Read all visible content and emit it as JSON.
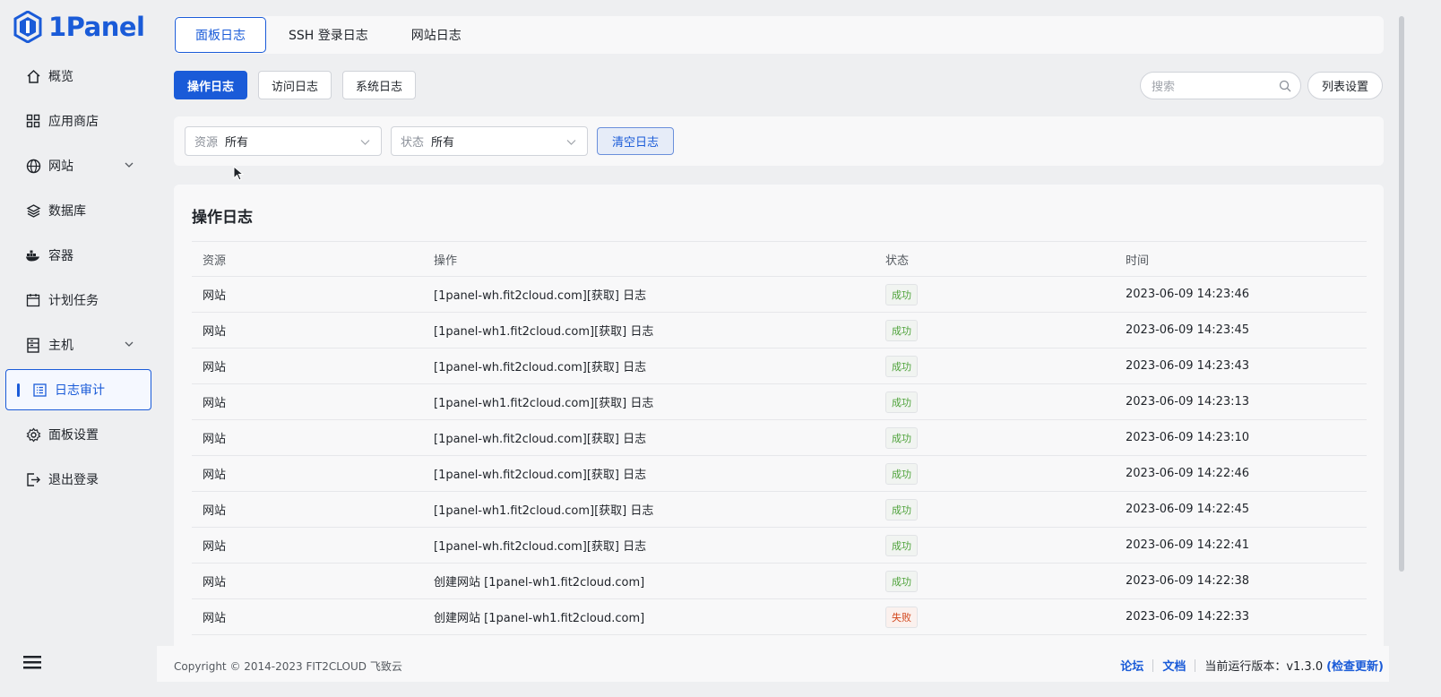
{
  "app": {
    "logo_text": "1Panel"
  },
  "sidebar": {
    "items": [
      {
        "label": "概览",
        "icon": "home-icon"
      },
      {
        "label": "应用商店",
        "icon": "grid-icon"
      },
      {
        "label": "网站",
        "icon": "globe-icon",
        "expandable": true
      },
      {
        "label": "数据库",
        "icon": "layers-icon"
      },
      {
        "label": "容器",
        "icon": "docker-icon"
      },
      {
        "label": "计划任务",
        "icon": "calendar-icon"
      },
      {
        "label": "主机",
        "icon": "server-icon",
        "expandable": true
      },
      {
        "label": "日志审计",
        "icon": "log-icon",
        "active": true
      },
      {
        "label": "面板设置",
        "icon": "gear-icon"
      },
      {
        "label": "退出登录",
        "icon": "logout-icon"
      }
    ]
  },
  "top_tabs": [
    {
      "label": "面板日志",
      "active": true
    },
    {
      "label": "SSH 登录日志"
    },
    {
      "label": "网站日志"
    }
  ],
  "sub_tabs": [
    {
      "label": "操作日志",
      "active": true
    },
    {
      "label": "访问日志"
    },
    {
      "label": "系统日志"
    }
  ],
  "search": {
    "placeholder": "搜索"
  },
  "column_settings_label": "列表设置",
  "filters": {
    "resource": {
      "label": "资源",
      "value": "所有"
    },
    "status": {
      "label": "状态",
      "value": "所有"
    },
    "clear_label": "清空日志"
  },
  "table": {
    "title": "操作日志",
    "headers": [
      "资源",
      "操作",
      "状态",
      "时间"
    ],
    "rows": [
      {
        "resource": "网站",
        "operation": "[1panel-wh.fit2cloud.com][获取] 日志",
        "status": "成功",
        "ok": true,
        "time": "2023-06-09 14:23:46"
      },
      {
        "resource": "网站",
        "operation": "[1panel-wh1.fit2cloud.com][获取] 日志",
        "status": "成功",
        "ok": true,
        "time": "2023-06-09 14:23:45"
      },
      {
        "resource": "网站",
        "operation": "[1panel-wh.fit2cloud.com][获取] 日志",
        "status": "成功",
        "ok": true,
        "time": "2023-06-09 14:23:43"
      },
      {
        "resource": "网站",
        "operation": "[1panel-wh1.fit2cloud.com][获取] 日志",
        "status": "成功",
        "ok": true,
        "time": "2023-06-09 14:23:13"
      },
      {
        "resource": "网站",
        "operation": "[1panel-wh.fit2cloud.com][获取] 日志",
        "status": "成功",
        "ok": true,
        "time": "2023-06-09 14:23:10"
      },
      {
        "resource": "网站",
        "operation": "[1panel-wh.fit2cloud.com][获取] 日志",
        "status": "成功",
        "ok": true,
        "time": "2023-06-09 14:22:46"
      },
      {
        "resource": "网站",
        "operation": "[1panel-wh1.fit2cloud.com][获取] 日志",
        "status": "成功",
        "ok": true,
        "time": "2023-06-09 14:22:45"
      },
      {
        "resource": "网站",
        "operation": "[1panel-wh.fit2cloud.com][获取] 日志",
        "status": "成功",
        "ok": true,
        "time": "2023-06-09 14:22:41"
      },
      {
        "resource": "网站",
        "operation": "创建网站 [1panel-wh1.fit2cloud.com]",
        "status": "成功",
        "ok": true,
        "time": "2023-06-09 14:22:38"
      },
      {
        "resource": "网站",
        "operation": "创建网站 [1panel-wh1.fit2cloud.com]",
        "status": "失败",
        "ok": false,
        "time": "2023-06-09 14:22:33"
      }
    ]
  },
  "footer": {
    "copyright": "Copyright © 2014-2023 FIT2CLOUD 飞致云",
    "forum": "论坛",
    "docs": "文档",
    "version_text": "当前运行版本：v1.3.0",
    "check_update": "(检查更新)"
  },
  "colors": {
    "accent": "#1a5bd8",
    "success": "#4fa33b",
    "fail": "#d2461b"
  }
}
